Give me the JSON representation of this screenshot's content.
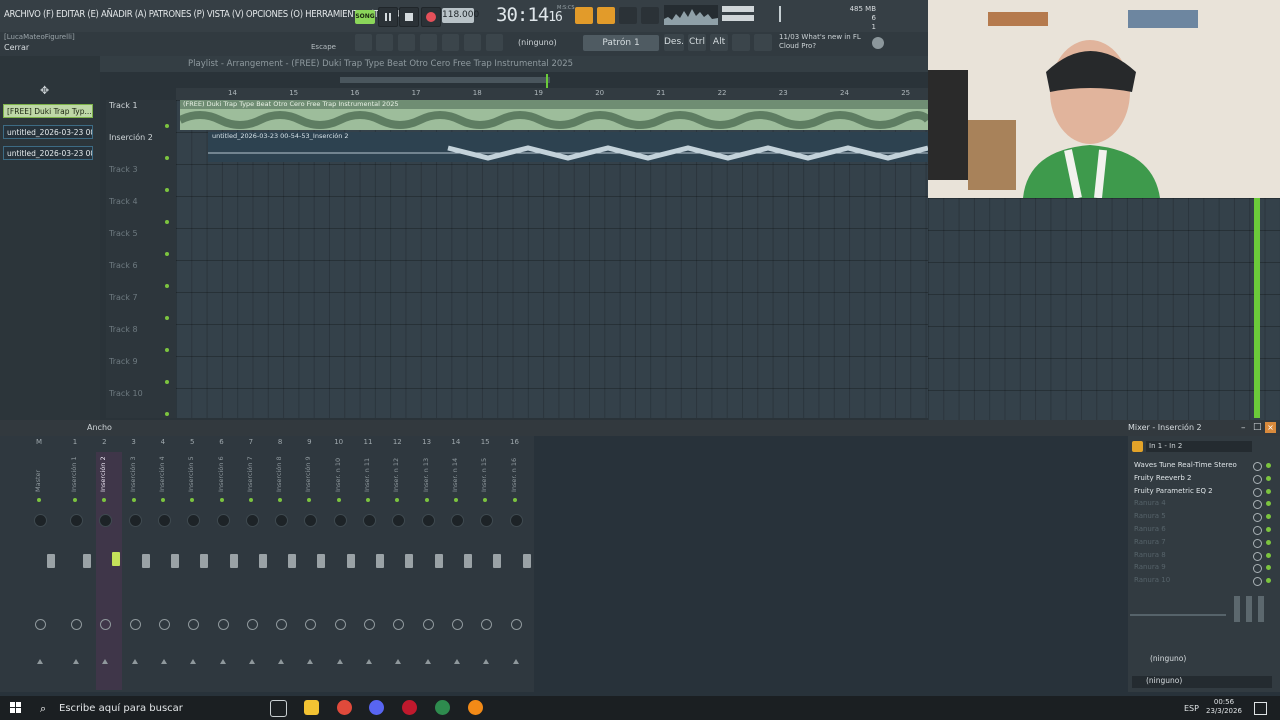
{
  "topbar": {
    "menu": "ARCHIVO (F) EDITAR (E) AÑADIR (A) PATRONES (P) VISTA (V) OPCIONES (O) HERRAMIENTAS (T) AYUDA",
    "song_label": "SONG",
    "tempo": "118.000",
    "time": "30:14",
    "time_sub": "16",
    "time_label": "M:S:CS",
    "cpu": "6",
    "memory": "485 MB",
    "voices": "1"
  },
  "bar2": {
    "user": "[LucaMateoFigurelli]",
    "close": "Cerrar",
    "escape": "Escape",
    "snap": "(ninguno)",
    "pattern": "Patrón 1",
    "des": "Des.",
    "ctrl": "Ctrl",
    "alt": "Alt",
    "news_date": "11/03",
    "news_line1": "What's new in FL",
    "news_line2": "Cloud Pro?"
  },
  "browser": {
    "items": [
      {
        "label": "[FREE] Duki Trap Typ...",
        "selected": true
      },
      {
        "label": "untitled_2026-03-23 00-...",
        "selected": false
      },
      {
        "label": "untitled_2026-03-23 00-...",
        "selected": false
      }
    ]
  },
  "playlist": {
    "title": "Playlist - Arrangement - (FREE) Duki Trap Type Beat Otro Cero  Free Trap Instrumental 2025",
    "ruler": [
      "14",
      "15",
      "16",
      "17",
      "18",
      "19",
      "20",
      "21",
      "22",
      "23",
      "24",
      "25"
    ],
    "tracks": [
      "Track 1",
      "Inserción 2",
      "Track 3",
      "Track 4",
      "Track 5",
      "Track 6",
      "Track 7",
      "Track 8",
      "Track 9",
      "Track 10"
    ],
    "clip1": "(FREE) Duki Trap Type Beat Otro Cero  Free Trap Instrumental 2025",
    "clip2": "untitled_2026-03-23 00-54-53_Inserción 2"
  },
  "mixer": {
    "toolbar_label": "Ancho",
    "title": "Mixer - Inserción 2",
    "strips": [
      {
        "num": "M",
        "name": "Master"
      },
      {
        "num": "1",
        "name": "Inserción 1"
      },
      {
        "num": "2",
        "name": "Inserción 2"
      },
      {
        "num": "3",
        "name": "Inserción 3"
      },
      {
        "num": "4",
        "name": "Inserción 4"
      },
      {
        "num": "5",
        "name": "Inserción 5"
      },
      {
        "num": "6",
        "name": "Inserción 6"
      },
      {
        "num": "7",
        "name": "Inserción 7"
      },
      {
        "num": "8",
        "name": "Inserción 8"
      },
      {
        "num": "9",
        "name": "Inserción 9"
      },
      {
        "num": "10",
        "name": "Inser. n 10"
      },
      {
        "num": "11",
        "name": "Inser. n 11"
      },
      {
        "num": "12",
        "name": "Inser. n 12"
      },
      {
        "num": "13",
        "name": "Inser. n 13"
      },
      {
        "num": "14",
        "name": "Inser. n 14"
      },
      {
        "num": "15",
        "name": "Inser. n 15"
      },
      {
        "num": "16",
        "name": "Inser. n 16"
      }
    ],
    "input": "In 1 - In 2",
    "fx": [
      "Waves Tune Real-Time Stereo",
      "Fruity Reeverb 2",
      "Fruity Parametric EQ 2",
      "Ranura 4",
      "Ranura 5",
      "Ranura 6",
      "Ranura 7",
      "Ranura 8",
      "Ranura 9",
      "Ranura 10"
    ],
    "out1": "(ninguno)",
    "out2": "(ninguno)"
  },
  "taskbar": {
    "search": "Escribe aquí para buscar",
    "lang": "ESP",
    "time": "00:56",
    "date": "23/3/2026"
  }
}
